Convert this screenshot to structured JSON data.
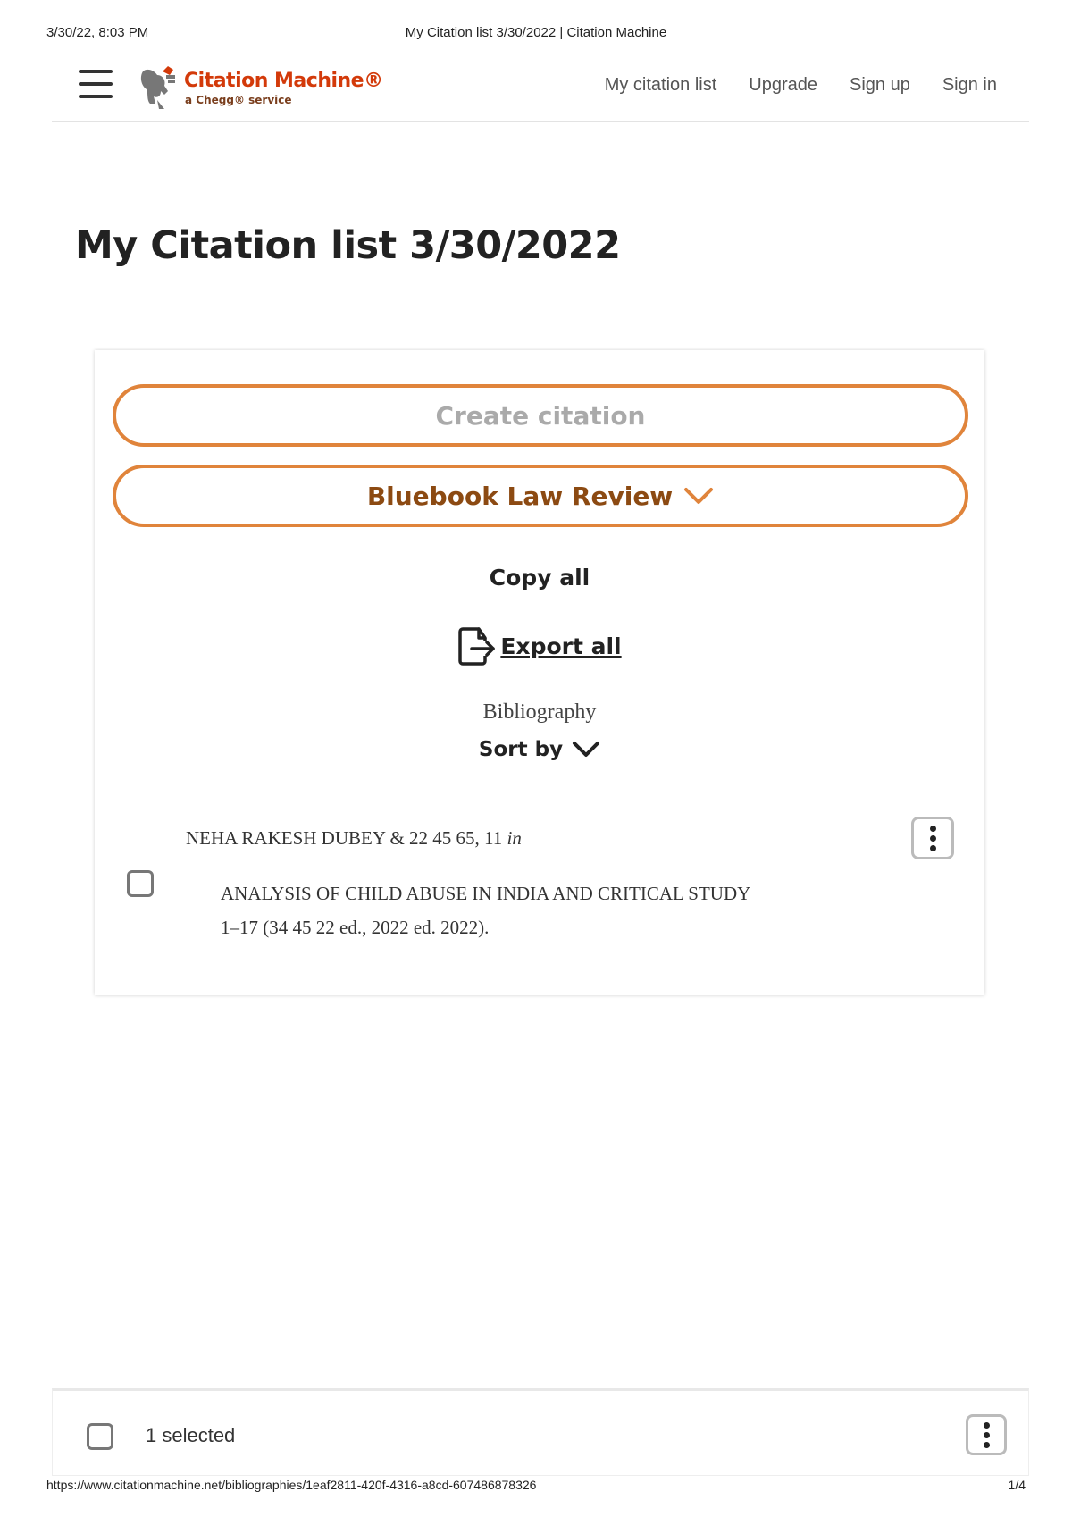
{
  "print_header": {
    "datetime": "3/30/22, 8:03 PM",
    "doc_title": "My Citation list 3/30/2022 | Citation Machine"
  },
  "nav": {
    "logo_text": "Citation Machine®",
    "logo_subtext": "a Chegg® service",
    "links": [
      "My citation list",
      "Upgrade",
      "Sign up",
      "Sign in"
    ]
  },
  "page": {
    "title": "My Citation list 3/30/2022"
  },
  "panel": {
    "create_label": "Create citation",
    "style_label": "Bluebook Law Review",
    "copy_all": "Copy all",
    "export_all": "Export all",
    "section_heading": "Bibliography",
    "sort_by": "Sort by"
  },
  "citation": {
    "line1": "NEHA RAKESH DUBEY & 22 45 65, 11 ",
    "line1_italic": "in",
    "line2": "ANALYSIS OF CHILD ABUSE IN INDIA AND CRITICAL STUDY",
    "line3": "1–17 (34 45 22 ed., 2022 ed. 2022)."
  },
  "selection_bar": {
    "selected_text": "1 selected"
  },
  "print_footer": {
    "url": "https://www.citationmachine.net/bibliographies/1eaf2811-420f-4316-a8cd-607486878326",
    "page": "1/4"
  },
  "colors": {
    "accent_orange": "#e0843b",
    "brand_red": "#d33a0a",
    "style_brown": "#8c4a12"
  }
}
